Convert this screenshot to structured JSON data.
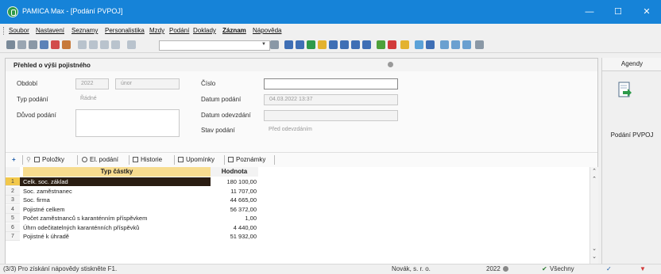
{
  "window": {
    "title": "PAMICA Max - [Podání PVPOJ]",
    "minimize": "—",
    "maximize": "☐",
    "close": "✕"
  },
  "menu": [
    "Soubor",
    "Nastavení",
    "Seznamy",
    "Personalistika",
    "Mzdy",
    "Podání",
    "Doklady",
    "Záznam",
    "Nápověda"
  ],
  "panel": {
    "title": "Přehled o výši pojistného"
  },
  "form": {
    "obdobi_label": "Období",
    "obdobi_year": "2022",
    "obdobi_month": "únor",
    "typ_label": "Typ podání",
    "typ_value": "Řádné",
    "duvod_label": "Důvod podání",
    "cislo_label": "Číslo",
    "datum_podani_label": "Datum podání",
    "datum_podani_value": "04.03.2022 13:37",
    "datum_odevzdani_label": "Datum odevzdání",
    "stav_label": "Stav podání",
    "stav_value": "Před odevzdáním"
  },
  "tabs": {
    "plus": "+",
    "items": [
      "Položky",
      "El. podání",
      "Historie",
      "Upomínky",
      "Poznámky"
    ]
  },
  "grid": {
    "headers": [
      "Typ částky",
      "Hodnota"
    ],
    "rows": [
      {
        "n": "1",
        "name": "Celk. soc. základ",
        "value": "180 100,00"
      },
      {
        "n": "2",
        "name": "Soc. zaměstnanec",
        "value": "11 707,00"
      },
      {
        "n": "3",
        "name": "Soc. firma",
        "value": "44 665,00"
      },
      {
        "n": "4",
        "name": "Pojistné celkem",
        "value": "56 372,00"
      },
      {
        "n": "5",
        "name": "Počet zaměstnanců s karanténním příspěvkem",
        "value": "1,00"
      },
      {
        "n": "6",
        "name": "Úhrn odečitatelných karanténních příspěvků",
        "value": "4 440,00"
      },
      {
        "n": "7",
        "name": "Pojistné k úhradě",
        "value": "51 932,00"
      }
    ]
  },
  "status": {
    "help": "(3/3) Pro získání nápovědy stiskněte F1.",
    "company": "Novák, s. r. o.",
    "year": "2022",
    "filter": "Všechny"
  },
  "agendy": {
    "title": "Agendy",
    "item": "Podání PVPOJ"
  },
  "colors": {
    "titlebar": "#1683d8",
    "header": "#f7dc8f",
    "selected_row_num": "#f2c84b"
  }
}
